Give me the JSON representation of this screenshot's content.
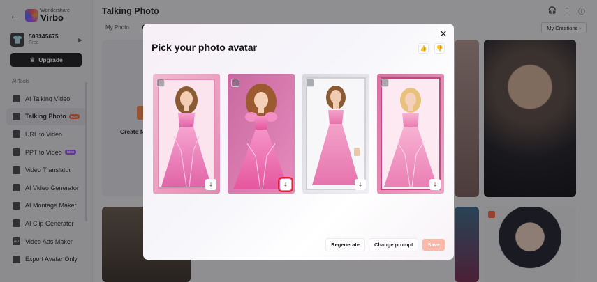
{
  "app": {
    "brand_top": "Wondershare",
    "brand_name": "Virbo",
    "page_title": "Talking Photo"
  },
  "account": {
    "id": "503345675",
    "plan": "Free",
    "upgrade_label": "Upgrade"
  },
  "sidebar": {
    "section_label": "AI Tools",
    "items": [
      {
        "label": "AI Talking Video",
        "icon": "talking-video-icon"
      },
      {
        "label": "Talking Photo",
        "icon": "talking-photo-icon",
        "badge": "HOT",
        "active": true
      },
      {
        "label": "URL to Video",
        "icon": "url-icon"
      },
      {
        "label": "PPT to Video",
        "icon": "ppt-icon",
        "badge": "NEW"
      },
      {
        "label": "Video Translator",
        "icon": "translate-icon"
      },
      {
        "label": "AI Video Generator",
        "icon": "video-generator-icon"
      },
      {
        "label": "AI Montage Maker",
        "icon": "montage-icon"
      },
      {
        "label": "AI Clip Generator",
        "icon": "clip-icon"
      },
      {
        "label": "Video Ads Maker",
        "icon": "ads-icon",
        "icon_text": "AD"
      },
      {
        "label": "Export Avatar Only",
        "icon": "export-icon"
      }
    ]
  },
  "tabs": [
    {
      "label": "My Photo"
    },
    {
      "label": "A",
      "active": true
    }
  ],
  "my_creations_label": "My Creations",
  "create_tile_label": "Create N",
  "modal": {
    "title": "Pick your photo avatar",
    "close_icon": "close-icon",
    "feedback": [
      "thumbs-up-icon",
      "thumbs-down-icon"
    ],
    "avatars": [
      {
        "id": 1,
        "highlighted": false
      },
      {
        "id": 2,
        "highlighted": true
      },
      {
        "id": 3,
        "highlighted": false
      },
      {
        "id": 4,
        "highlighted": false
      }
    ],
    "buttons": {
      "regenerate": "Regenerate",
      "change_prompt": "Change prompt",
      "save": "Save"
    }
  },
  "colors": {
    "accent": "#ff6a3c",
    "highlight": "#e2232a",
    "save_disabled": "#ffb8a8",
    "dress_pink": "#f07ab8"
  }
}
